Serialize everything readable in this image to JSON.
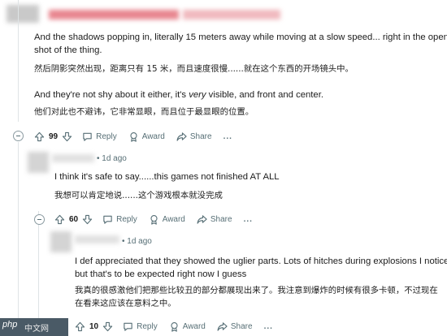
{
  "comment1": {
    "lines_en": [
      "And the shadows popping in, literally 15 meters away while moving at a slow speed... right in the opening",
      "shot of the thing."
    ],
    "line_zh_1": "然后阴影突然出现，距离只有 15 米，而且速度很慢......就在这个东西的开场镜头中。",
    "line_en_2_pre": "And they're not shy about it either, it's ",
    "line_en_2_em": "very",
    "line_en_2_post": " visible, and front and center.",
    "line_zh_2": "他们对此也不避讳，它非常显眼，而且位于最显眼的位置。",
    "score": "99",
    "reply_label": "Reply",
    "award_label": "Award",
    "share_label": "Share",
    "more_label": "..."
  },
  "comment2": {
    "time": "1d ago",
    "line_en": "I think it's safe to say......this games not finished AT ALL",
    "line_zh": "我想可以肯定地说......这个游戏根本就没完成",
    "score": "60",
    "reply_label": "Reply",
    "award_label": "Award",
    "share_label": "Share",
    "more_label": "..."
  },
  "comment3": {
    "time": "1d ago",
    "lines_en": [
      "I def appreciated that they showed the uglier parts. Lots of hitches during explosions I noticed",
      "but that's to be expected right now I guess"
    ],
    "lines_zh": [
      "我真的很感激他们把那些比较丑的部分都展现出来了。我注意到爆炸的时候有很多卡顿，不过现在",
      "在看来这应该在意料之中。"
    ],
    "score": "10",
    "reply_label": "Reply",
    "award_label": "Award",
    "share_label": "Share",
    "more_label": "..."
  },
  "watermark": {
    "logo": "php",
    "site": "中文网"
  },
  "colors": {
    "accent": "#e8868f",
    "meta": "#576f76",
    "thread": "#dfe4e6"
  },
  "icons": [
    "collapse-icon",
    "upvote-icon",
    "downvote-icon",
    "reply-icon",
    "award-icon",
    "share-icon",
    "more-icon"
  ]
}
